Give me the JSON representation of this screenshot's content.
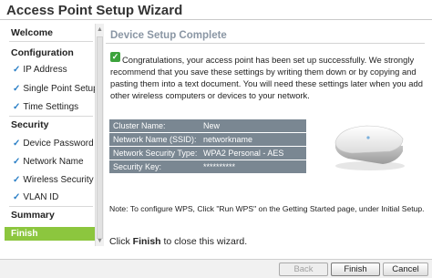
{
  "window": {
    "title": "Access Point Setup Wizard"
  },
  "sidebar": {
    "items": [
      {
        "label": "Welcome",
        "kind": "section"
      },
      {
        "label": "Configuration",
        "kind": "section"
      },
      {
        "label": "IP Address",
        "kind": "sub",
        "check": "✓"
      },
      {
        "label": "Single Point Setup",
        "kind": "sub",
        "check": "✓"
      },
      {
        "label": "Time Settings",
        "kind": "sub",
        "check": "✓"
      },
      {
        "label": "Security",
        "kind": "section"
      },
      {
        "label": "Device Password",
        "kind": "sub",
        "check": "✓"
      },
      {
        "label": "Network Name",
        "kind": "sub",
        "check": "✓"
      },
      {
        "label": "Wireless Security",
        "kind": "sub",
        "check": "✓"
      },
      {
        "label": "VLAN ID",
        "kind": "sub",
        "check": "✓"
      },
      {
        "label": "Summary",
        "kind": "section"
      },
      {
        "label": "Finish",
        "kind": "active"
      }
    ],
    "active_color": "#8cc63e"
  },
  "main": {
    "heading": "Device Setup Complete",
    "status_icon": "check-icon",
    "message": "Congratulations, your access point has been set up successfully. We strongly recommend that you save these settings by writing them down or by copying and pasting them into a text document. You will need these settings later when you add other wireless computers or devices to your network.",
    "info": [
      {
        "key": "Cluster Name:",
        "value": "New"
      },
      {
        "key": "Network Name (SSID):",
        "value": "networkname"
      },
      {
        "key": "Network Security Type:",
        "value": "WPA2 Personal - AES"
      },
      {
        "key": "Security Key:",
        "value": "**********"
      }
    ],
    "device_image": "access-point-device-icon",
    "note": "Note: To configure WPS, Click \"Run WPS\" on the Getting Started page, under Initial Setup.",
    "finish_prefix": "Click ",
    "finish_bold": "Finish",
    "finish_suffix": " to close this wizard."
  },
  "buttons": {
    "back": "Back",
    "finish": "Finish",
    "cancel": "Cancel"
  }
}
